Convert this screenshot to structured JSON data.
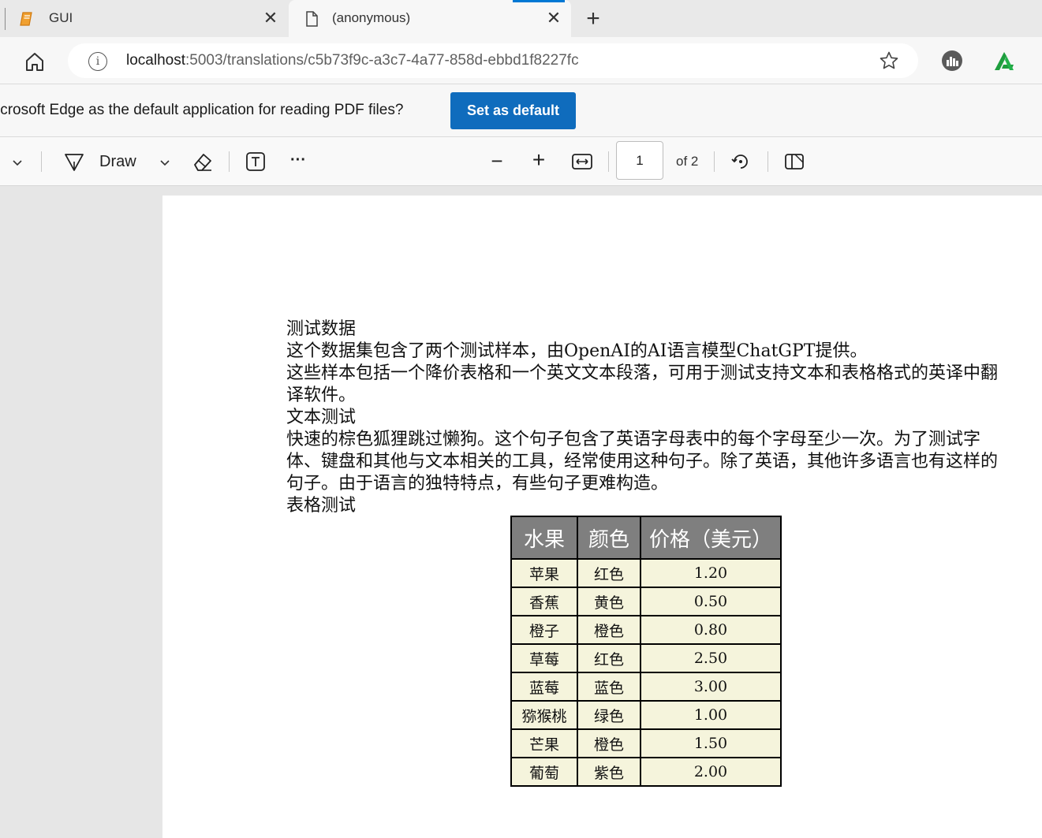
{
  "browser": {
    "tabs": [
      {
        "title": "GUI"
      },
      {
        "title": "(anonymous)"
      }
    ],
    "new_tab": "+",
    "close": "✕",
    "address": {
      "host": "localhost",
      "path": ":5003/translations/c5b73f9c-a3c7-4a77-858d-ebbd1f8227fc"
    }
  },
  "banner": {
    "text": "icrosoft Edge as the default application for reading PDF files?",
    "button": "Set as default"
  },
  "pdf_toolbar": {
    "draw_label": "Draw",
    "more": "···",
    "zoom_out": "−",
    "zoom_in": "+",
    "page_current": "1",
    "page_of": "of 2"
  },
  "document": {
    "heading": "测试数据",
    "intro1": "这个数据集包含了两个测试样本，由OpenAI的AI语言模型ChatGPT提供。",
    "intro2": "这些样本包括一个降价表格和一个英文文本段落，可用于测试支持文本和表格格式的英译中翻译软件。",
    "text_test_heading": "文本测试",
    "text_test_body": "快速的棕色狐狸跳过懒狗。这个句子包含了英语字母表中的每个字母至少一次。为了测试字体、键盘和其他与文本相关的工具，经常使用这种句子。除了英语，其他许多语言也有这样的句子。由于语言的独特特点，有些句子更难构造。",
    "table_test_heading": "表格测试",
    "table": {
      "headers": [
        "水果",
        "颜色",
        "价格（美元）"
      ],
      "rows": [
        [
          "苹果",
          "红色",
          "1.20"
        ],
        [
          "香蕉",
          "黄色",
          "0.50"
        ],
        [
          "橙子",
          "橙色",
          "0.80"
        ],
        [
          "草莓",
          "红色",
          "2.50"
        ],
        [
          "蓝莓",
          "蓝色",
          "3.00"
        ],
        [
          "猕猴桃",
          "绿色",
          "1.00"
        ],
        [
          "芒果",
          "橙色",
          "1.50"
        ],
        [
          "葡萄",
          "紫色",
          "2.00"
        ]
      ]
    }
  },
  "colors": {
    "accent": "#0f6cbd",
    "table_header_bg": "#7f7f7f",
    "table_cell_bg": "#f5f4dc",
    "profile_green": "#1e9e3e"
  }
}
